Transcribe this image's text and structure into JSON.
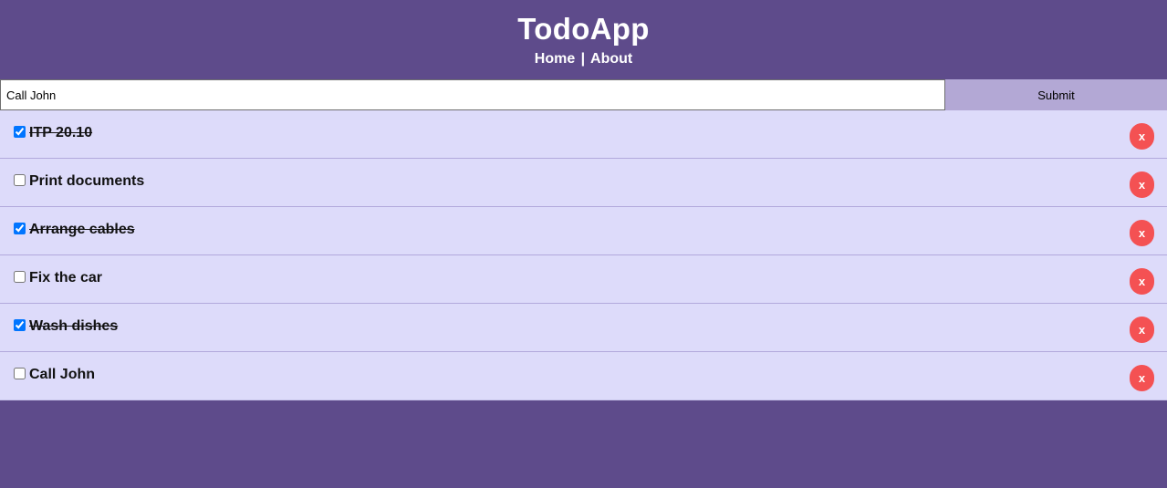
{
  "app": {
    "title": "TodoApp",
    "nav": {
      "home": "Home",
      "separator": "|",
      "about": "About"
    }
  },
  "form": {
    "input_value": "Call John",
    "submit_label": "Submit"
  },
  "todos": [
    {
      "text": "ITP 20.10",
      "done": true
    },
    {
      "text": "Print documents",
      "done": false
    },
    {
      "text": "Arrange cables",
      "done": true
    },
    {
      "text": "Fix the car",
      "done": false
    },
    {
      "text": "Wash dishes",
      "done": true
    },
    {
      "text": "Call John",
      "done": false
    }
  ],
  "delete_label": "x",
  "colors": {
    "background": "#5e4b8b",
    "list_background": "#dddbfa",
    "submit_background": "#b3a8d5",
    "delete_button": "#f45153",
    "divider": "#b2a9dc"
  }
}
